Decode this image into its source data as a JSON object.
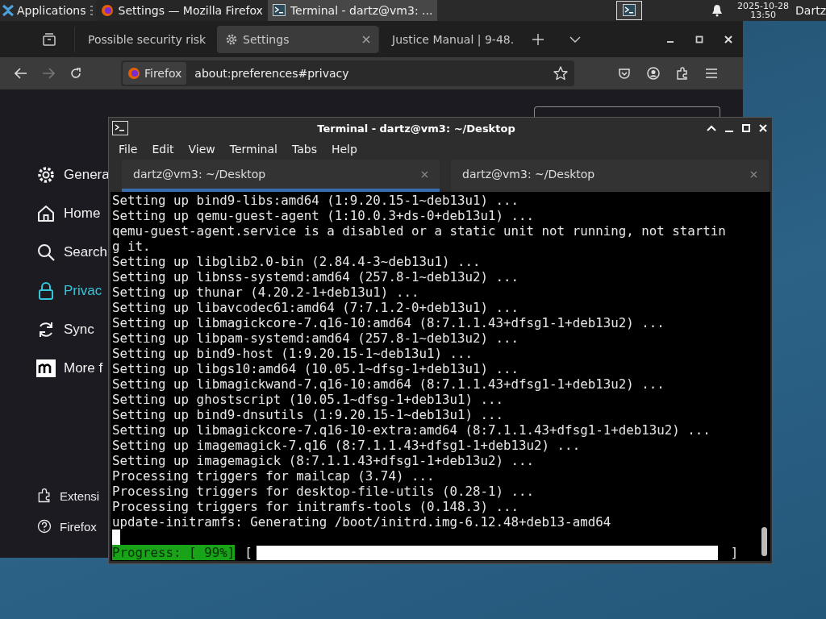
{
  "taskbar": {
    "apps_menu": "Applications",
    "tasks": [
      {
        "kind": "firefox",
        "title": "Settings — Mozilla Firefox",
        "selected": false
      },
      {
        "kind": "terminal",
        "title": "Terminal - dartz@vm3: ...",
        "selected": true
      }
    ],
    "clock_date": "2025-10-28",
    "clock_time": "13:50",
    "user": "Dartz"
  },
  "browser": {
    "tabs": [
      {
        "kind": "warning",
        "title": "Possible security risk",
        "selected": false
      },
      {
        "kind": "settings",
        "title": "Settings",
        "selected": true
      },
      {
        "kind": "site",
        "title": "Justice Manual | 9-48.",
        "selected": false
      }
    ],
    "identity": "Firefox",
    "url": "about:preferences#privacy",
    "sidebar": {
      "items": [
        {
          "kind": "gear",
          "label": "Genera",
          "selected": false
        },
        {
          "kind": "home",
          "label": "Home",
          "selected": false
        },
        {
          "kind": "search",
          "label": "Search",
          "selected": false
        },
        {
          "kind": "lock",
          "label": "Privac",
          "selected": true
        },
        {
          "kind": "sync",
          "label": "Sync",
          "selected": false
        },
        {
          "kind": "m",
          "label": "More f",
          "selected": false
        }
      ],
      "footer": [
        {
          "kind": "puzzle",
          "label": "Extensi"
        },
        {
          "kind": "help",
          "label": "Firefox"
        }
      ]
    }
  },
  "terminal": {
    "title": "Terminal - dartz@vm3: ~/Desktop",
    "menu": [
      "File",
      "Edit",
      "View",
      "Terminal",
      "Tabs",
      "Help"
    ],
    "tabs": [
      {
        "title": "dartz@vm3: ~/Desktop",
        "selected": true
      },
      {
        "title": "dartz@vm3: ~/Desktop",
        "selected": false
      }
    ],
    "lines": [
      "Setting up bind9-libs:amd64 (1:9.20.15-1~deb13u1) ...",
      "Setting up qemu-guest-agent (1:10.0.3+ds-0+deb13u1) ...",
      "qemu-guest-agent.service is a disabled or a static unit not running, not startin",
      "g it.",
      "Setting up libglib2.0-bin (2.84.4-3~deb13u1) ...",
      "Setting up libnss-systemd:amd64 (257.8-1~deb13u2) ...",
      "Setting up thunar (4.20.2-1+deb13u1) ...",
      "Setting up libavcodec61:amd64 (7:7.1.2-0+deb13u1) ...",
      "Setting up libmagickcore-7.q16-10:amd64 (8:7.1.1.43+dfsg1-1+deb13u2) ...",
      "Setting up libpam-systemd:amd64 (257.8-1~deb13u2) ...",
      "Setting up bind9-host (1:9.20.15-1~deb13u1) ...",
      "Setting up libgs10:amd64 (10.05.1~dfsg-1+deb13u1) ...",
      "Setting up libmagickwand-7.q16-10:amd64 (8:7.1.1.43+dfsg1-1+deb13u2) ...",
      "Setting up ghostscript (10.05.1~dfsg-1+deb13u1) ...",
      "Setting up bind9-dnsutils (1:9.20.15-1~deb13u1) ...",
      "Setting up libmagickcore-7.q16-10-extra:amd64 (8:7.1.1.43+dfsg1-1+deb13u2) ...",
      "Setting up imagemagick-7.q16 (8:7.1.1.43+dfsg1-1+deb13u2) ...",
      "Setting up imagemagick (8:7.1.1.43+dfsg1-1+deb13u2) ...",
      "Processing triggers for mailcap (3.74) ...",
      "Processing triggers for desktop-file-utils (0.28-1) ...",
      "Processing triggers for initramfs-tools (0.148.3) ...",
      "update-initramfs: Generating /boot/initrd.img-6.12.48+deb13-amd64"
    ],
    "progress": {
      "label": "Progress: [ 99%]",
      "open": "[",
      "close": "]",
      "level": 0.99
    }
  }
}
